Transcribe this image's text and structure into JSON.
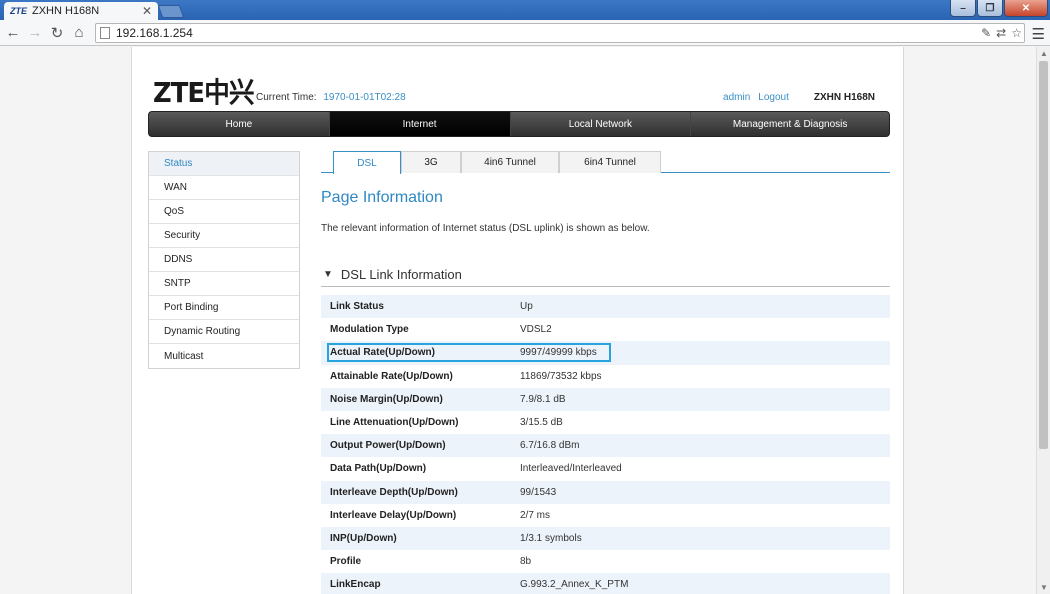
{
  "browser": {
    "tab_title": "ZXHN H168N",
    "tab_favicon_text": "ZTE",
    "url": "192.168.1.254",
    "icons": [
      "back-icon",
      "forward-icon",
      "reload-icon",
      "home-icon",
      "page-icon",
      "extension-icon",
      "translate-icon",
      "bookmark-star-icon",
      "menu-icon"
    ]
  },
  "header": {
    "logo": "ZTE中兴",
    "current_time_label": "Current Time:",
    "current_time_value": "1970-01-01T02:28",
    "user": "admin",
    "logout": "Logout",
    "model": "ZXHN H168N"
  },
  "main_nav": [
    {
      "label": "Home"
    },
    {
      "label": "Internet",
      "active": true
    },
    {
      "label": "Local Network"
    },
    {
      "label": "Management & Diagnosis"
    }
  ],
  "left_menu": [
    {
      "label": "Status",
      "active": true
    },
    {
      "label": "WAN"
    },
    {
      "label": "QoS"
    },
    {
      "label": "Security"
    },
    {
      "label": "DDNS"
    },
    {
      "label": "SNTP"
    },
    {
      "label": "Port Binding"
    },
    {
      "label": "Dynamic Routing"
    },
    {
      "label": "Multicast"
    }
  ],
  "sub_tabs": [
    {
      "label": "DSL",
      "active": true
    },
    {
      "label": "3G"
    },
    {
      "label": "4in6 Tunnel"
    },
    {
      "label": "6in4 Tunnel"
    }
  ],
  "page": {
    "title": "Page Information",
    "description": "The relevant information of Internet status (DSL uplink) is shown as below.",
    "section_title": "DSL Link Information"
  },
  "dsl_info": [
    {
      "key": "Link Status",
      "value": "Up"
    },
    {
      "key": "Modulation Type",
      "value": "VDSL2"
    },
    {
      "key": "Actual Rate(Up/Down)",
      "value": "9997/49999 kbps",
      "highlighted": true
    },
    {
      "key": "Attainable Rate(Up/Down)",
      "value": "11869/73532 kbps"
    },
    {
      "key": "Noise Margin(Up/Down)",
      "value": "7.9/8.1 dB"
    },
    {
      "key": "Line Attenuation(Up/Down)",
      "value": "3/15.5 dB"
    },
    {
      "key": "Output Power(Up/Down)",
      "value": "6.7/16.8 dBm"
    },
    {
      "key": "Data Path(Up/Down)",
      "value": "Interleaved/Interleaved"
    },
    {
      "key": "Interleave Depth(Up/Down)",
      "value": "99/1543"
    },
    {
      "key": "Interleave Delay(Up/Down)",
      "value": "2/7 ms"
    },
    {
      "key": "INP(Up/Down)",
      "value": "1/3.1 symbols"
    },
    {
      "key": "Profile",
      "value": "8b"
    },
    {
      "key": "LinkEncap",
      "value": "G.993.2_Annex_K_PTM"
    }
  ],
  "colors": {
    "accent": "#2f88c3",
    "highlight_border": "#27a4dd",
    "nav_active": "#000000"
  }
}
